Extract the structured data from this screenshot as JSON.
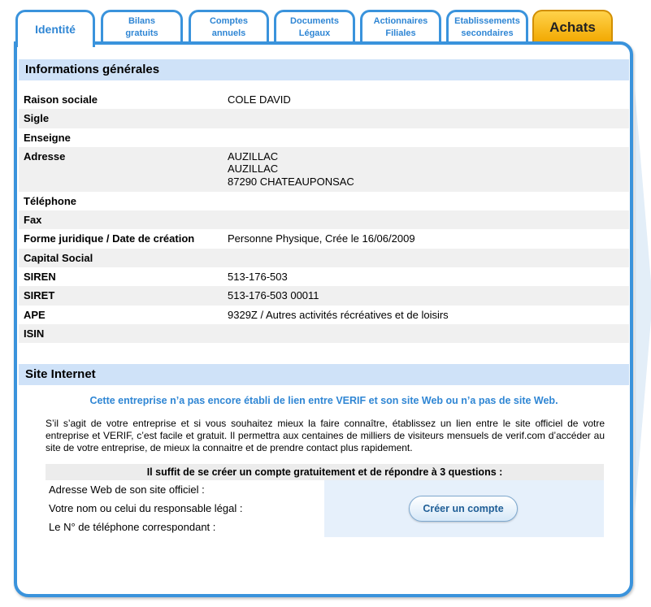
{
  "tabs": [
    {
      "label": "Identité"
    },
    {
      "label": "Bilans\ngratuits"
    },
    {
      "label": "Comptes\nannuels"
    },
    {
      "label": "Documents\nLégaux"
    },
    {
      "label": "Actionnaires\nFiliales"
    },
    {
      "label": "Etablissements\nsecondaires"
    },
    {
      "label": "Achats"
    }
  ],
  "info": {
    "heading": "Informations générales",
    "rows": [
      {
        "label": "Raison sociale",
        "value": "COLE DAVID"
      },
      {
        "label": "Sigle",
        "value": ""
      },
      {
        "label": "Enseigne",
        "value": ""
      },
      {
        "label": "Adresse",
        "value": "AUZILLAC\nAUZILLAC\n87290   CHATEAUPONSAC"
      },
      {
        "label": "Téléphone",
        "value": ""
      },
      {
        "label": "Fax",
        "value": ""
      },
      {
        "label": "Forme juridique / Date de création",
        "value": "Personne Physique, Crée le 16/06/2009"
      },
      {
        "label": "Capital Social",
        "value": ""
      },
      {
        "label": "SIREN",
        "value": "513-176-503"
      },
      {
        "label": "SIRET",
        "value": "513-176-503 00011"
      },
      {
        "label": "APE",
        "value": "9329Z / Autres activités récréatives et de loisirs"
      },
      {
        "label": "ISIN",
        "value": ""
      }
    ]
  },
  "site": {
    "heading": "Site Internet",
    "title": "Cette entreprise n’a pas encore établi de lien entre VERIF et son site Web ou n’a pas de site Web.",
    "paragraph": "S’il s’agit de votre entreprise et si vous souhaitez mieux la faire connaître, établissez un lien entre le site officiel de votre entreprise et VERIF, c’est facile et gratuit. Il permettra aux centaines de milliers de visiteurs mensuels de verif.com d’accéder au site de votre entreprise, de mieux la connaitre et de prendre contact plus rapidement.",
    "questions_heading": "Il suffit de se créer un compte gratuitement et de répondre à 3 questions :",
    "questions": [
      "Adresse Web de son site officiel :",
      "Votre nom ou celui du responsable légal :",
      "Le N° de téléphone correspondant :"
    ],
    "button_label": "Créer un compte"
  },
  "colors": {
    "accent": "#3a93dc",
    "section_bg": "#cfe2f8",
    "achats": "#f2a800"
  }
}
